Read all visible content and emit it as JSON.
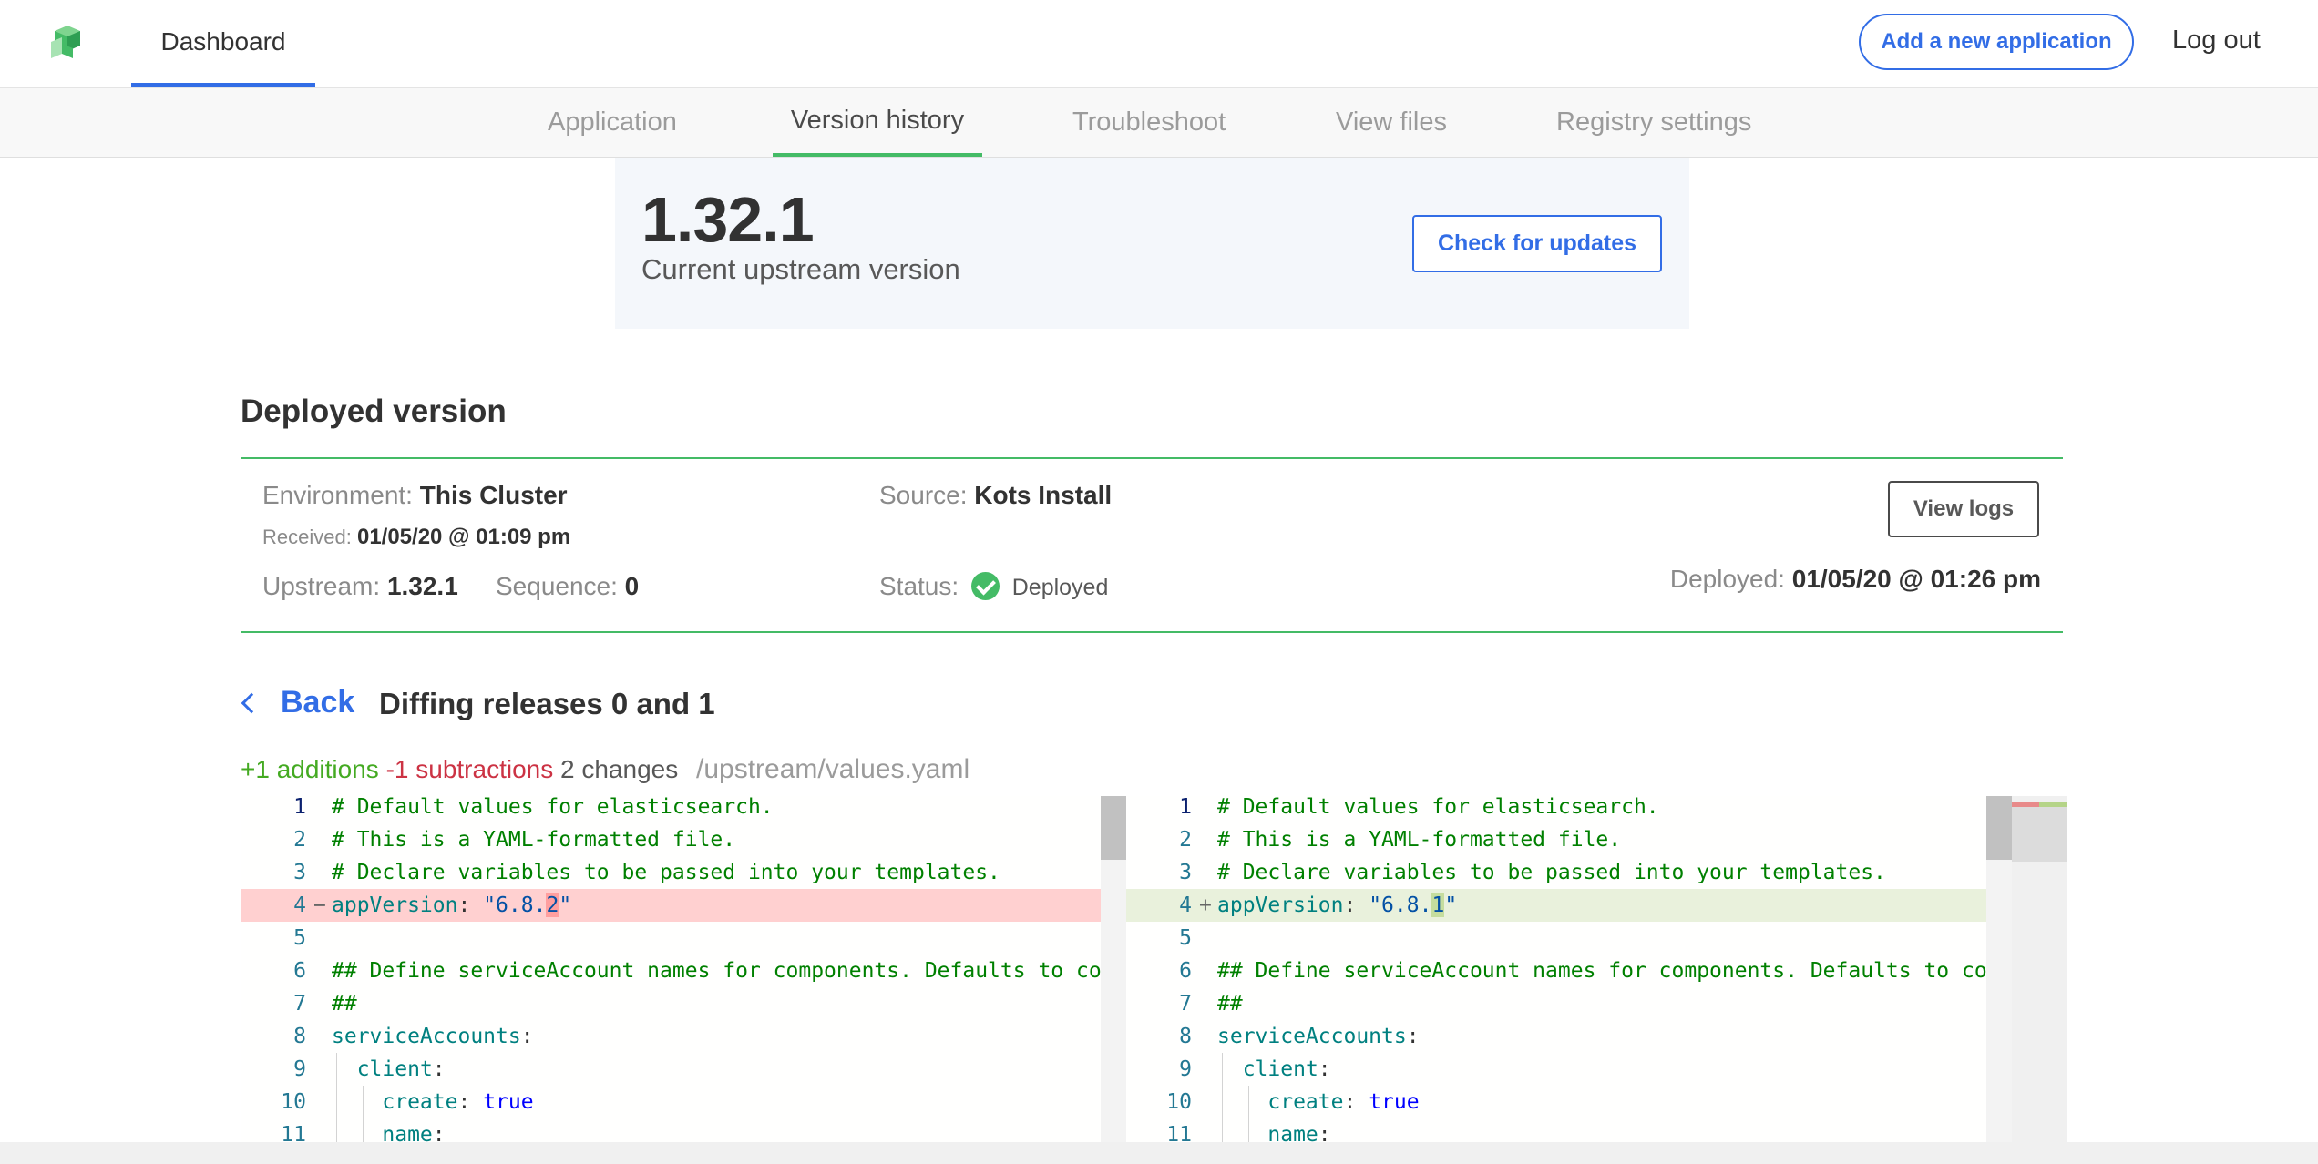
{
  "header": {
    "dashboard_label": "Dashboard",
    "add_app_label": "Add a new application",
    "logout_label": "Log out"
  },
  "subnav": {
    "tabs": [
      {
        "label": "Application"
      },
      {
        "label": "Version history"
      },
      {
        "label": "Troubleshoot"
      },
      {
        "label": "View files"
      },
      {
        "label": "Registry settings"
      }
    ],
    "active": "Version history"
  },
  "upstream": {
    "version": "1.32.1",
    "label": "Current upstream version",
    "check_label": "Check for updates"
  },
  "deployed": {
    "title": "Deployed version",
    "environment_label": "Environment:",
    "environment_value": "This Cluster",
    "received_label": "Received:",
    "received_value": "01/05/20 @ 01:09 pm",
    "upstream_label": "Upstream:",
    "upstream_value": "1.32.1",
    "sequence_label": "Sequence:",
    "sequence_value": "0",
    "source_label": "Source:",
    "source_value": "Kots Install",
    "status_label": "Status:",
    "status_value": "Deployed",
    "view_logs_label": "View logs",
    "deployed_label": "Deployed:",
    "deployed_value": "01/05/20 @ 01:26 pm"
  },
  "diff": {
    "back_label": "Back",
    "title": "Diffing releases 0 and 1",
    "additions": "+1 additions",
    "subtractions": "-1 subtractions",
    "changes": "2 changes",
    "path": "/upstream/values.yaml"
  },
  "editor": {
    "left": [
      {
        "n": "1",
        "text": "# Default values for elasticsearch."
      },
      {
        "n": "2",
        "text": "# This is a YAML-formatted file."
      },
      {
        "n": "3",
        "text": "# Declare variables to be passed into your templates."
      },
      {
        "n": "4",
        "text": "appVersion: \"6.8.2\"",
        "mark": "−"
      },
      {
        "n": "5",
        "text": ""
      },
      {
        "n": "6",
        "text": "## Define serviceAccount names for components. Defaults to co"
      },
      {
        "n": "7",
        "text": "##"
      },
      {
        "n": "8",
        "text": "serviceAccounts:"
      },
      {
        "n": "9",
        "text": "  client:"
      },
      {
        "n": "10",
        "text": "    create: true"
      },
      {
        "n": "11",
        "text": "    name:"
      }
    ],
    "right": [
      {
        "n": "1",
        "text": "# Default values for elasticsearch."
      },
      {
        "n": "2",
        "text": "# This is a YAML-formatted file."
      },
      {
        "n": "3",
        "text": "# Declare variables to be passed into your templates."
      },
      {
        "n": "4",
        "text": "appVersion: \"6.8.1\"",
        "mark": "+"
      },
      {
        "n": "5",
        "text": ""
      },
      {
        "n": "6",
        "text": "## Define serviceAccount names for components. Defaults to co"
      },
      {
        "n": "7",
        "text": "##"
      },
      {
        "n": "8",
        "text": "serviceAccounts:"
      },
      {
        "n": "9",
        "text": "  client:"
      },
      {
        "n": "10",
        "text": "    create: true"
      },
      {
        "n": "11",
        "text": "    name:"
      }
    ]
  },
  "colors": {
    "accent": "#326de6",
    "success": "#44bb66",
    "deleted_line": "#ffd0d0",
    "inserted_line": "#e9f1dc"
  },
  "icons": [
    "app-logo-icon",
    "check-circle-icon",
    "chevron-left-icon"
  ]
}
